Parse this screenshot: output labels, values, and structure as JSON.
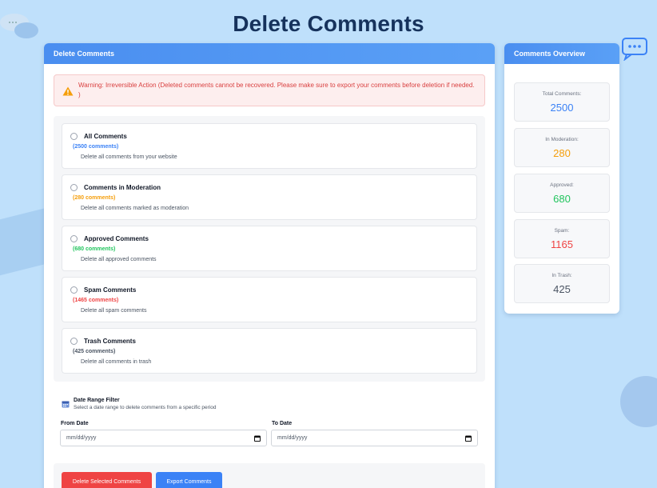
{
  "page": {
    "title": "Delete Comments"
  },
  "main": {
    "header": "Delete Comments",
    "warning": {
      "icon": "warning-triangle-icon",
      "text": "Warning: Irreversible Action (Deleted comments cannot be recovered. Please make sure to export your comments before deletion if needed. )"
    },
    "options": [
      {
        "title": "All Comments",
        "count": "(2500 comments)",
        "desc": "Delete all comments from your website",
        "color": "#3b82f6"
      },
      {
        "title": "Comments in Moderation",
        "count": "(280 comments)",
        "desc": "Delete all comments marked as moderation",
        "color": "#f59e0b"
      },
      {
        "title": "Approved Comments",
        "count": "(680 comments)",
        "desc": "Delete all approved comments",
        "color": "#22c55e"
      },
      {
        "title": "Spam Comments",
        "count": "(1465 comments)",
        "desc": "Delete all spam comments",
        "color": "#ef4444"
      },
      {
        "title": "Trash Comments",
        "count": "(425 comments)",
        "desc": "Delete all comments in trash",
        "color": "#4b5563"
      }
    ],
    "date_filter": {
      "icon": "calendar-icon",
      "title": "Date Range Filter",
      "subtitle": "Select a date range to delete comments from a specific period",
      "from_label": "From Date",
      "to_label": "To Date",
      "from_placeholder": "mm/dd/yyyy",
      "to_placeholder": "mm/dd/yyyy"
    },
    "actions": {
      "delete_label": "Delete Selected Comments",
      "export_label": "Export Comments"
    }
  },
  "overview": {
    "header": "Comments Overview",
    "stats": [
      {
        "label": "Total Comments:",
        "value": "2500",
        "color": "#3b82f6"
      },
      {
        "label": "In Moderation:",
        "value": "280",
        "color": "#f59e0b"
      },
      {
        "label": "Approved:",
        "value": "680",
        "color": "#22c55e"
      },
      {
        "label": "Spam:",
        "value": "1165",
        "color": "#ef4444"
      },
      {
        "label": "In Trash:",
        "value": "425",
        "color": "#4b5563"
      }
    ]
  },
  "colors": {
    "accent": "#4a8ef0",
    "danger": "#ef4444",
    "background": "#bfe0fb"
  }
}
